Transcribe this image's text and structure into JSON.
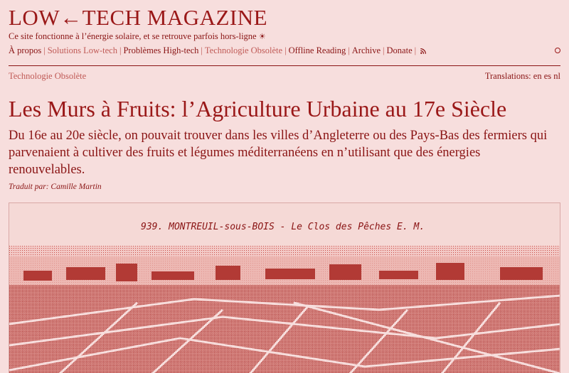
{
  "header": {
    "site_title": "LOW←TECH MAGAZINE",
    "tagline": "Ce site fonctionne à l’énergie solaire, et se retrouve parfois hors-ligne",
    "sun_symbol": "☀"
  },
  "nav": {
    "items": [
      {
        "label": "À propos",
        "muted": false
      },
      {
        "label": "Solutions Low-tech",
        "muted": true
      },
      {
        "label": "Problèmes High-tech",
        "muted": false
      },
      {
        "label": "Technologie Obsolète",
        "muted": true
      },
      {
        "label": "Offline Reading",
        "muted": false
      },
      {
        "label": "Archive",
        "muted": false
      },
      {
        "label": "Donate",
        "muted": false
      }
    ],
    "separator": "|",
    "rss_icon": "rss-icon",
    "toggle_icon": "circle-icon"
  },
  "article": {
    "category": "Technologie Obsolète",
    "translations_label": "Translations:",
    "translations": [
      "en",
      "es",
      "nl"
    ],
    "title": "Les Murs à Fruits: l’Agriculture Urbaine au 17e Siècle",
    "lede": "Du 16e au 20e siècle, on pouvait trouver dans les villes d’Angleterre ou des Pays-Bas des fermiers qui parvenaient à cultiver des fruits et légumes méditerranéens en n’utilisant que des énergies renouvelables.",
    "byline": "Traduit par: Camille Martin",
    "image_caption": "939. MONTREUIL-sous-BOIS - Le Clos des Pêches E. M."
  },
  "colors": {
    "background": "#f7dedd",
    "text": "#8a1414",
    "muted": "#c05a56"
  }
}
